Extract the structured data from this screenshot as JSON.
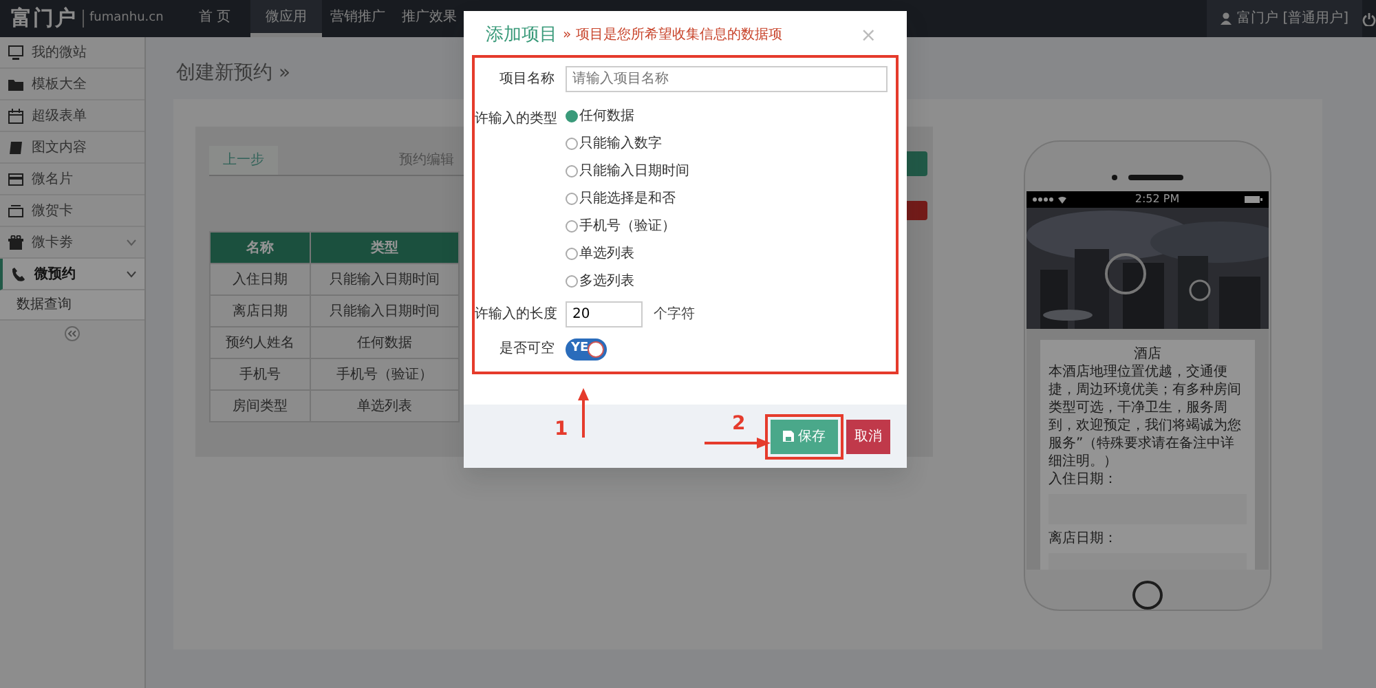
{
  "header": {
    "logo": "富门户",
    "logo_domain": "fumanhu.cn",
    "nav": [
      {
        "label": "首 页",
        "selected": false
      },
      {
        "label": "微应用",
        "selected": true
      },
      {
        "label": "营销推广",
        "selected": false
      },
      {
        "label": "推广效果",
        "selected": false
      }
    ],
    "user": "富门户 [普通用户]"
  },
  "sidebar": {
    "items": [
      {
        "label": "我的微站",
        "selected": false
      },
      {
        "label": "模板大全",
        "selected": false
      },
      {
        "label": "超级表单",
        "selected": false
      },
      {
        "label": "图文内容",
        "selected": false
      },
      {
        "label": "微名片",
        "selected": false
      },
      {
        "label": "微贺卡",
        "selected": false
      },
      {
        "label": "微卡劵",
        "selected": false,
        "expanded": false
      },
      {
        "label": "微预约",
        "selected": true,
        "expanded": true,
        "children": [
          {
            "label": "数据查询"
          }
        ]
      }
    ]
  },
  "main": {
    "title": "创建新预约 »",
    "back_button": "上一步",
    "step_title": "预约编辑",
    "table": {
      "columns": [
        "名称",
        "类型"
      ],
      "rows": [
        [
          "入住日期",
          "只能输入日期时间"
        ],
        [
          "离店日期",
          "只能输入日期时间"
        ],
        [
          "预约人姓名",
          "任何数据"
        ],
        [
          "手机号",
          "手机号（验证）"
        ],
        [
          "房间类型",
          "单选列表"
        ]
      ]
    }
  },
  "phone": {
    "time": "2:52 PM",
    "title": "酒店",
    "description": "本酒店地理位置优越，交通便捷，周边环境优美；有多种房间类型可选，干净卫生，服务周到，欢迎预定，我们将竭诚为您服务”（特殊要求请在备注中详细注明。）",
    "fields": [
      "入住日期：",
      "离店日期："
    ]
  },
  "modal": {
    "title": "添加项目",
    "subtitle": "» 项目是您所希望收集信息的数据项",
    "close": "×",
    "name_label": "项目名称",
    "name_placeholder": "请输入项目名称",
    "type_label": "许输入的类型",
    "types": [
      {
        "label": "任何数据",
        "selected": true
      },
      {
        "label": "只能输入数字",
        "selected": false
      },
      {
        "label": "只能输入日期时间",
        "selected": false
      },
      {
        "label": "只能选择是和否",
        "selected": false
      },
      {
        "label": "手机号（验证）",
        "selected": false
      },
      {
        "label": "单选列表",
        "selected": false
      },
      {
        "label": "多选列表",
        "selected": false
      }
    ],
    "length_label": "许输入的长度",
    "length_value": "20",
    "length_unit": "个字符",
    "nullable_label": "是否可空",
    "nullable": {
      "label": "YE",
      "on": true
    },
    "save": "保存",
    "cancel": "取消",
    "annotations": [
      "1",
      "2"
    ]
  }
}
